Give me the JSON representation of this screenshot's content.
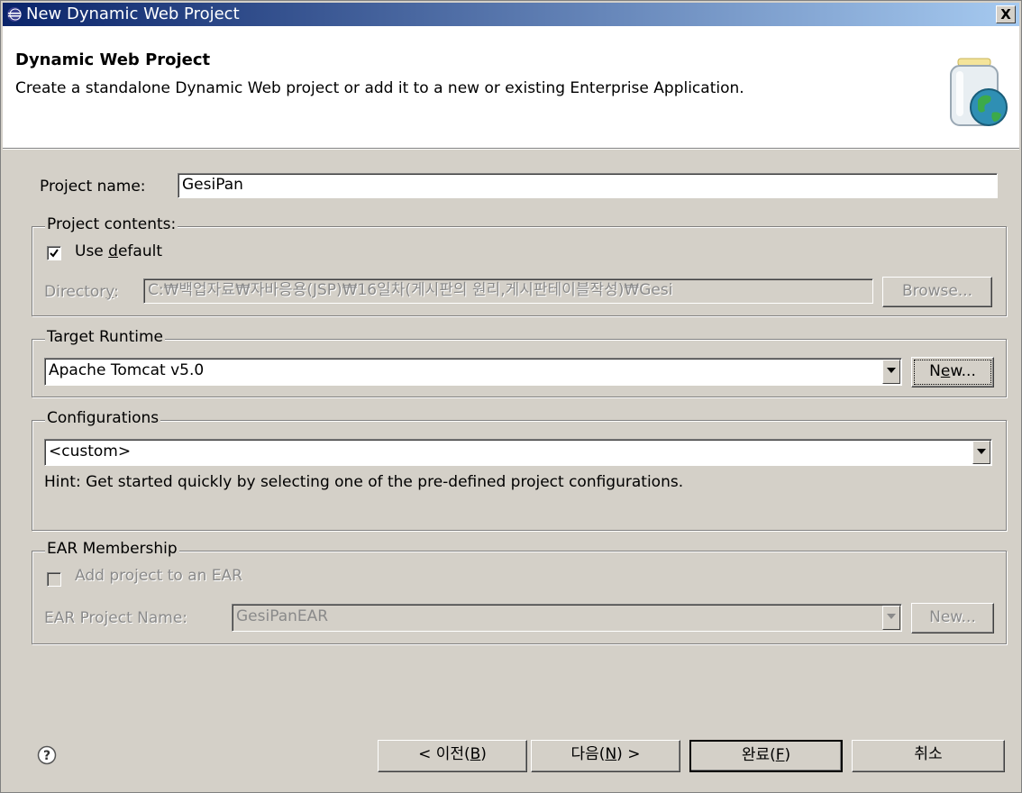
{
  "window": {
    "title": "New Dynamic Web Project",
    "close_label": "X"
  },
  "header": {
    "title": "Dynamic Web Project",
    "description": "Create a standalone Dynamic Web project or add it to a new or existing Enterprise Application."
  },
  "project_name": {
    "label": "Project name:",
    "value": "GesiPan"
  },
  "project_contents": {
    "group_label": "Project contents:",
    "use_default_label_pre": "Use ",
    "use_default_label_mn": "d",
    "use_default_label_post": "efault",
    "use_default_checked": true,
    "directory_label_pre": "Director",
    "directory_label_mn": "y",
    "directory_label_post": ":",
    "directory_value": "C:₩백업자료₩자바응용(JSP)₩16일차(게시판의 원리,게시판테이블작성)₩Gesi",
    "browse_label": "Browse..."
  },
  "target_runtime": {
    "group_label": "Target Runtime",
    "selected": "Apache Tomcat v5.0",
    "new_label_pre": "N",
    "new_label_mn": "e",
    "new_label_post": "w..."
  },
  "configurations": {
    "group_label": "Configurations",
    "selected": "<custom>",
    "hint": "Hint: Get started quickly by selecting one of the pre-defined project configurations."
  },
  "ear_membership": {
    "group_label": "EAR Membership",
    "add_label": "Add project to an EAR",
    "add_checked": false,
    "ear_name_label": "EAR Project Name:",
    "ear_name_value": "GesiPanEAR",
    "new_label": "New..."
  },
  "footer": {
    "back_pre": "< 이전(",
    "back_mn": "B",
    "back_post": ")",
    "next_pre": "다음(",
    "next_mn": "N",
    "next_post": ") >",
    "finish_pre": "완료(",
    "finish_mn": "F",
    "finish_post": ")",
    "cancel": "취소"
  },
  "colors": {
    "title_gradient_start": "#0a246a",
    "title_gradient_end": "#a6caf0",
    "dialog_bg": "#d4d0c8",
    "disabled_text": "#8a8a8a"
  },
  "icons": {
    "app": "eclipse-icon",
    "header": "web-project-globe-jar-icon",
    "help": "help-icon"
  }
}
